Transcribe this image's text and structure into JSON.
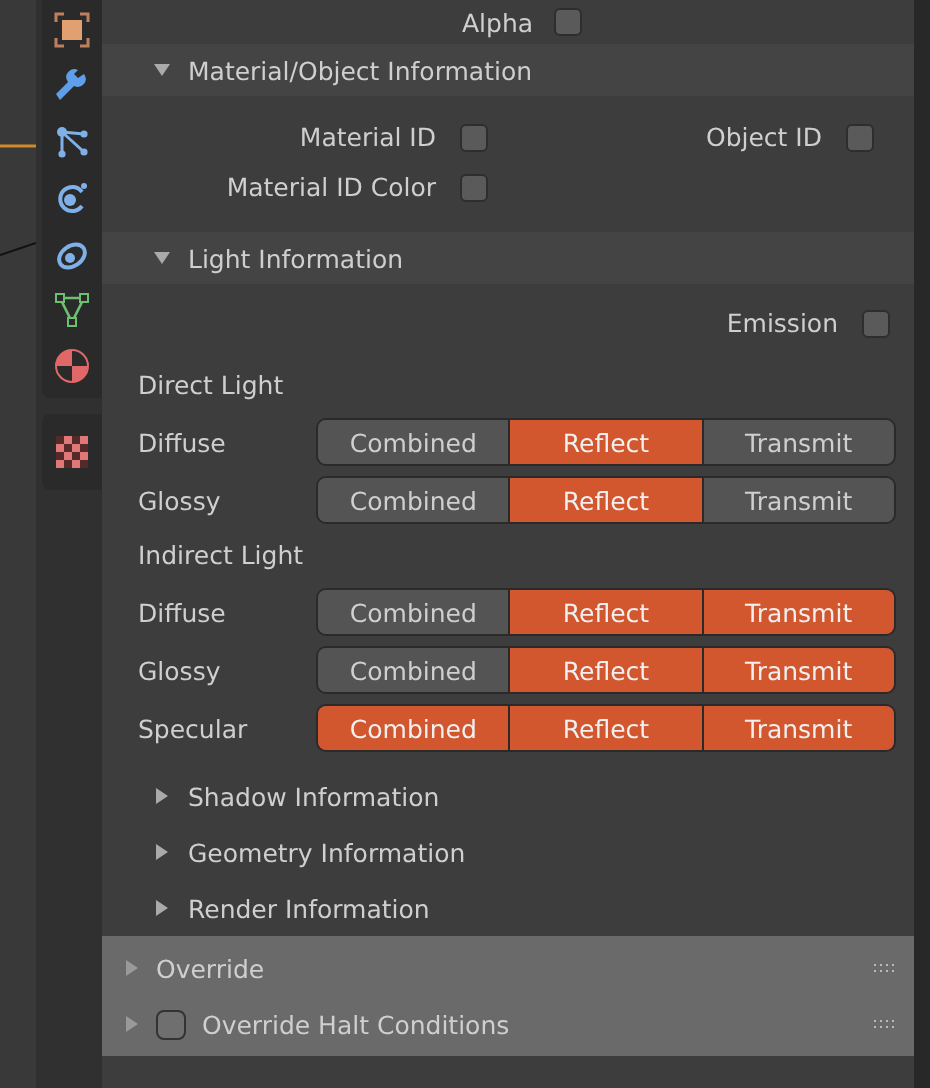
{
  "tabs": [
    {
      "kind": "object"
    },
    {
      "kind": "modifier"
    },
    {
      "kind": "particles"
    },
    {
      "kind": "physics"
    },
    {
      "kind": "constraints"
    },
    {
      "kind": "data"
    },
    {
      "kind": "material"
    },
    {
      "kind": "texture"
    }
  ],
  "alpha": {
    "label": "Alpha",
    "checked": false
  },
  "material_object": {
    "title": "Material/Object Information",
    "expanded": true,
    "options": [
      {
        "label": "Material ID",
        "checked": false
      },
      {
        "label": "Object ID",
        "checked": false
      },
      {
        "label": "Material ID Color",
        "checked": false
      }
    ]
  },
  "light_info": {
    "title": "Light Information",
    "expanded": true,
    "emission": {
      "label": "Emission",
      "checked": false
    },
    "groups": [
      {
        "title": "Direct Light",
        "rows": [
          {
            "label": "Diffuse",
            "segments": [
              {
                "label": "Combined",
                "on": false
              },
              {
                "label": "Reflect",
                "on": true
              },
              {
                "label": "Transmit",
                "on": false
              }
            ]
          },
          {
            "label": "Glossy",
            "segments": [
              {
                "label": "Combined",
                "on": false
              },
              {
                "label": "Reflect",
                "on": true
              },
              {
                "label": "Transmit",
                "on": false
              }
            ]
          }
        ]
      },
      {
        "title": "Indirect Light",
        "rows": [
          {
            "label": "Diffuse",
            "segments": [
              {
                "label": "Combined",
                "on": false
              },
              {
                "label": "Reflect",
                "on": true
              },
              {
                "label": "Transmit",
                "on": true
              }
            ]
          },
          {
            "label": "Glossy",
            "segments": [
              {
                "label": "Combined",
                "on": false
              },
              {
                "label": "Reflect",
                "on": true
              },
              {
                "label": "Transmit",
                "on": true
              }
            ]
          },
          {
            "label": "Specular",
            "segments": [
              {
                "label": "Combined",
                "on": true
              },
              {
                "label": "Reflect",
                "on": true
              },
              {
                "label": "Transmit",
                "on": true
              }
            ]
          }
        ]
      }
    ]
  },
  "subpanels": [
    {
      "title": "Shadow Information",
      "expanded": false
    },
    {
      "title": "Geometry Information",
      "expanded": false
    },
    {
      "title": "Render Information",
      "expanded": false
    }
  ],
  "override_panels": [
    {
      "title": "Override",
      "expanded": false
    },
    {
      "title": "Override Halt Conditions",
      "expanded": false,
      "checked": false
    }
  ]
}
